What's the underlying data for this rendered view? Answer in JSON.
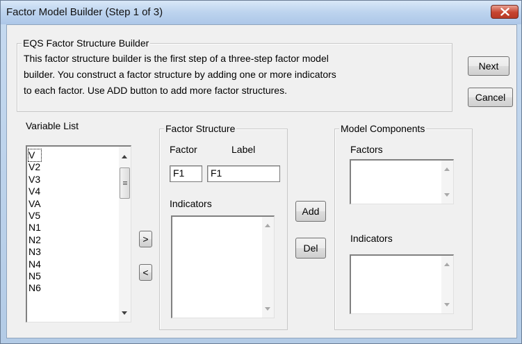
{
  "window": {
    "title": "Factor Model Builder (Step 1 of 3)"
  },
  "intro": {
    "group_title": "EQS Factor Structure Builder",
    "lines": [
      "This factor structure builder is the first step of a three-step factor model",
      "builder.  You construct a factor structure by adding one or more indicators",
      "to each factor.  Use ADD button to add more factor structures."
    ]
  },
  "buttons": {
    "next": "Next",
    "cancel": "Cancel",
    "add": "Add",
    "del": "Del",
    "move_right": ">",
    "move_left": "<"
  },
  "variable_list": {
    "label": "Variable List",
    "items": [
      "V",
      "V2",
      "V3",
      "V4",
      "VA",
      "V5",
      "N1",
      "N2",
      "N3",
      "N4",
      "N5",
      "N6"
    ]
  },
  "factor_structure": {
    "group_title": "Factor Structure",
    "factor_label": "Factor",
    "label_label": "Label",
    "factor_value": "F1",
    "label_value": "F1",
    "indicators_label": "Indicators"
  },
  "model_components": {
    "group_title": "Model Components",
    "factors_label": "Factors",
    "indicators_label": "Indicators"
  },
  "icons": {
    "close": "close-icon"
  },
  "colors": {
    "close_button": "#c6442f",
    "title_bar": "#bcd3ee",
    "dialog_face": "#f0f0f0"
  }
}
